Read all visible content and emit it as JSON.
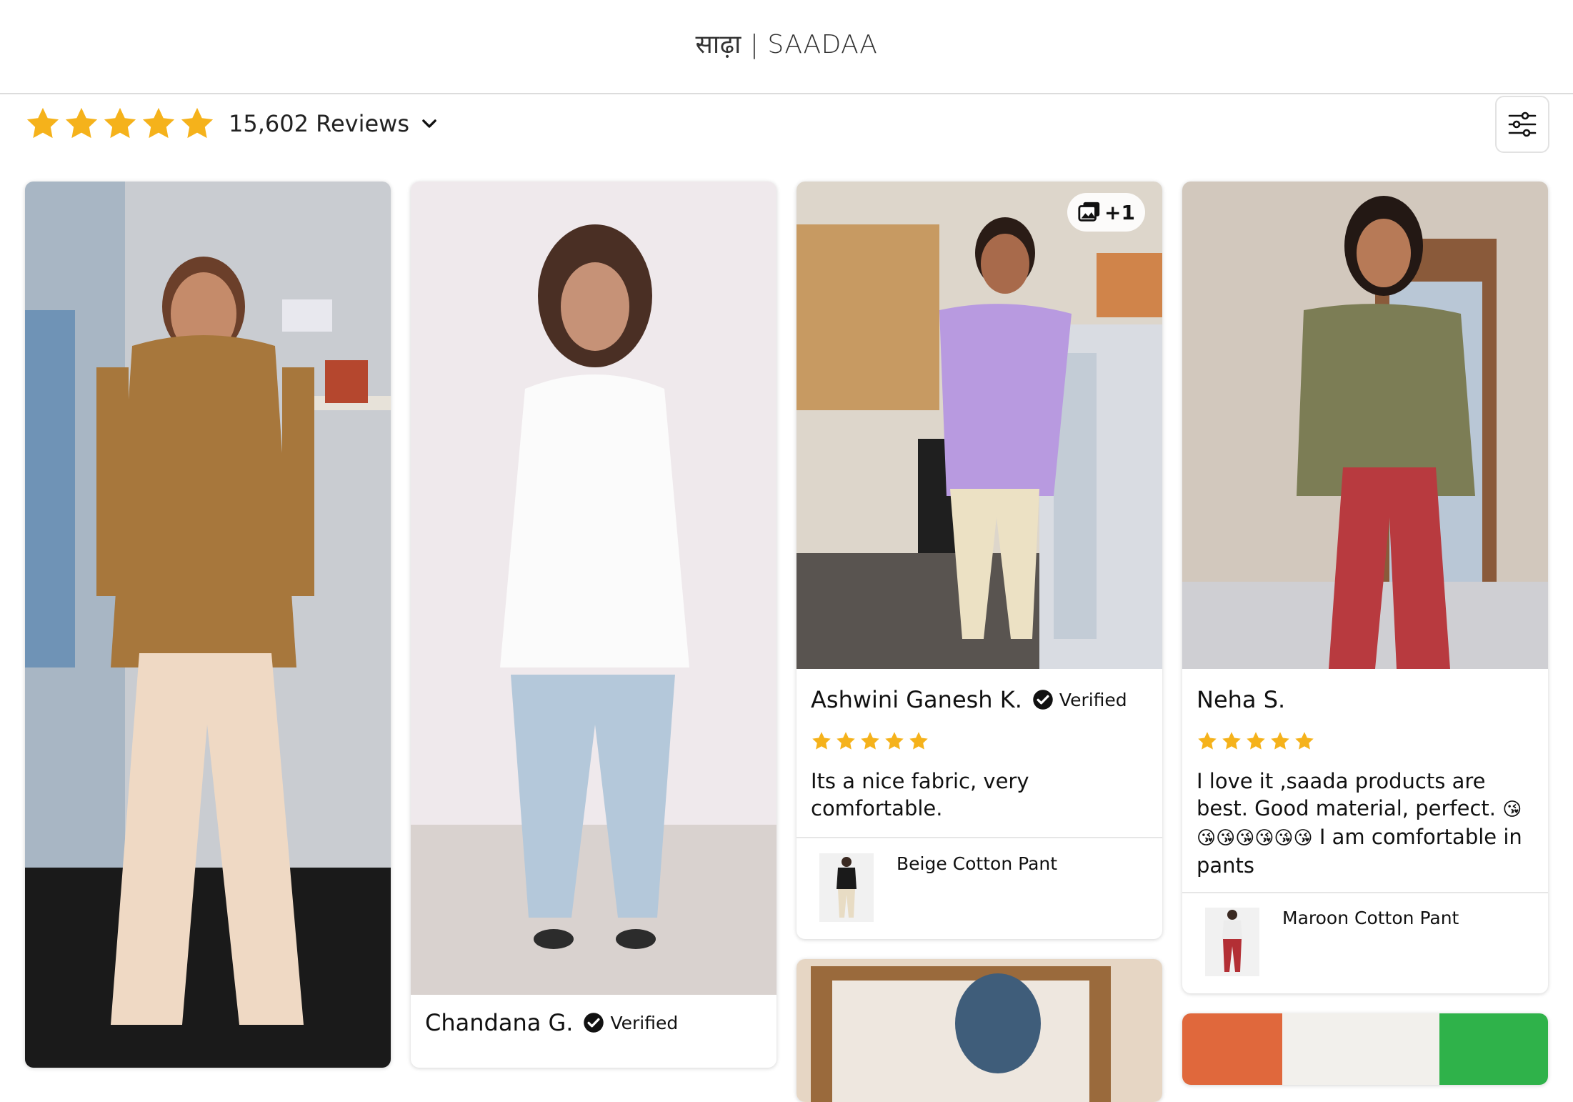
{
  "header": {
    "logo": "साढ़ा | SAADAA"
  },
  "summary": {
    "rating": 5,
    "reviews_label": "15,602 Reviews"
  },
  "colors": {
    "star": "#F5B21B",
    "check": "#111111"
  },
  "icons": {
    "filter": "filter-sliders-icon",
    "dropdown": "chevron-down-icon",
    "gallery": "image-gallery-icon"
  },
  "cards": [
    {
      "reviewer": "",
      "verified": "",
      "text": ""
    },
    {
      "reviewer": "Chandana G.",
      "verified": "Verified",
      "text": ""
    },
    {
      "reviewer": "Ashwini Ganesh K.",
      "verified": "Verified",
      "rating": 5,
      "text": "Its a nice fabric, very comfortable.",
      "product": "Beige Cotton Pant",
      "extra_images": "+1"
    },
    {
      "reviewer": "Neha S.",
      "verified": "",
      "rating": 5,
      "text_before_emoji": "I love it ,saada products are best. Good material, perfect.",
      "emoji": "😘😘😘😘😘😘😘",
      "text_after_emoji": " I am comfortable in pants",
      "product": "Maroon Cotton Pant"
    }
  ]
}
